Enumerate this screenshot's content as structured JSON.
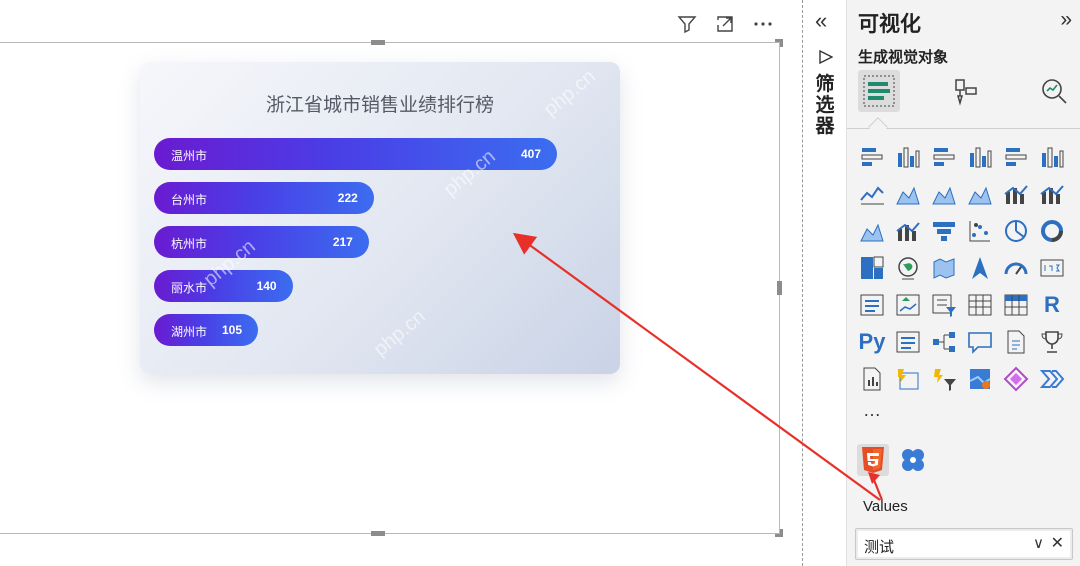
{
  "header_icons": [
    "filter-icon",
    "focus-mode-icon",
    "more-options-icon"
  ],
  "chart_data": {
    "type": "bar",
    "orientation": "horizontal",
    "title": "浙江省城市销售业绩排行榜",
    "categories": [
      "温州市",
      "台州市",
      "杭州市",
      "丽水市",
      "湖州市"
    ],
    "values": [
      407,
      222,
      217,
      140,
      105
    ],
    "colors": {
      "bar_start": "#6a1bd1",
      "bar_end": "#3b6df0",
      "label": "#ffffff"
    }
  },
  "watermark": "php.cn",
  "filter_pane": {
    "collapse": "«",
    "label": "筛选器"
  },
  "viz_pane": {
    "title": "可视化",
    "expand": "»",
    "section": "生成视觉对象",
    "more": "…",
    "values_label": "Values",
    "field": {
      "value": "测试",
      "chevron": "∨",
      "close": "✕"
    },
    "grid_labels": {
      "r": "R",
      "py": "Py"
    }
  },
  "accent": "#2d6fc0"
}
